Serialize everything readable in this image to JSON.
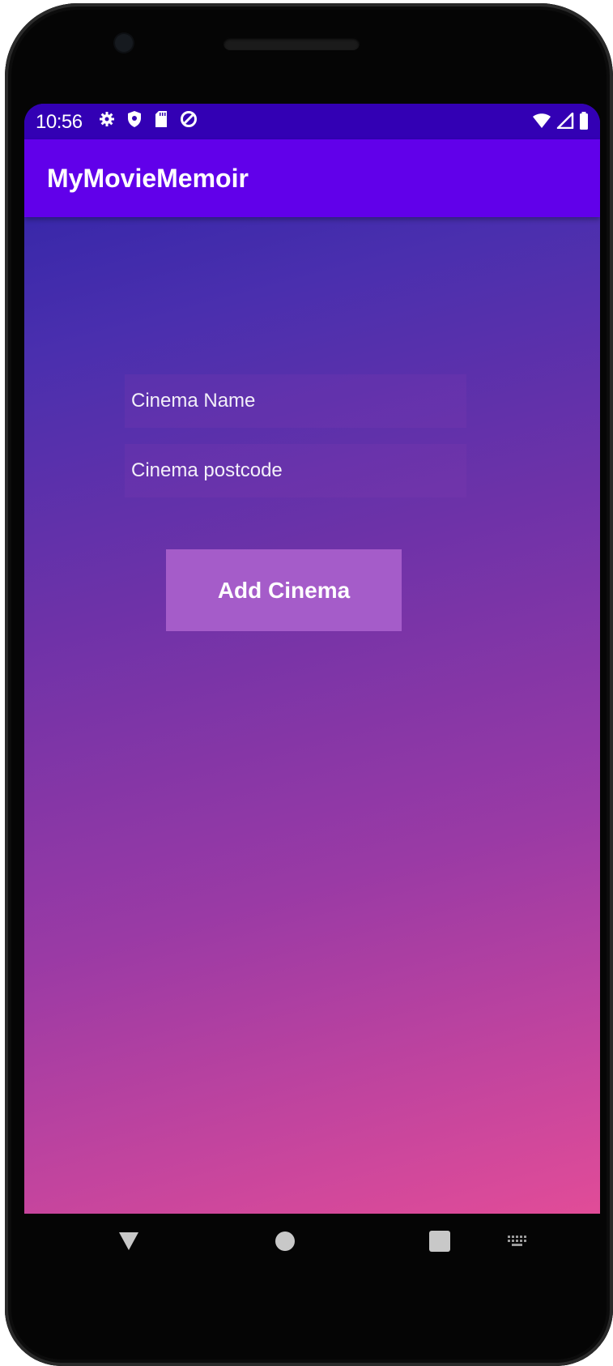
{
  "status_bar": {
    "time": "10:56",
    "icons_left": [
      "settings-icon",
      "shield-icon",
      "sd-card-icon",
      "data-saver-icon"
    ],
    "icons_right": [
      "wifi-icon",
      "signal-icon",
      "battery-icon"
    ]
  },
  "app_bar": {
    "title": "MyMovieMemoir"
  },
  "form": {
    "cinema_name_placeholder": "Cinema Name",
    "cinema_name_value": "",
    "cinema_postcode_placeholder": "Cinema postcode",
    "cinema_postcode_value": "",
    "submit_label": "Add Cinema"
  },
  "nav_bar": {
    "buttons": [
      "back-icon",
      "home-icon",
      "recents-icon",
      "keyboard-icon"
    ]
  },
  "colors": {
    "status_bar": "#3300b4",
    "app_bar": "#6100ea",
    "gradient_top": "#2b22a6",
    "gradient_bottom": "#e14c98",
    "button": "#a55cc9"
  }
}
